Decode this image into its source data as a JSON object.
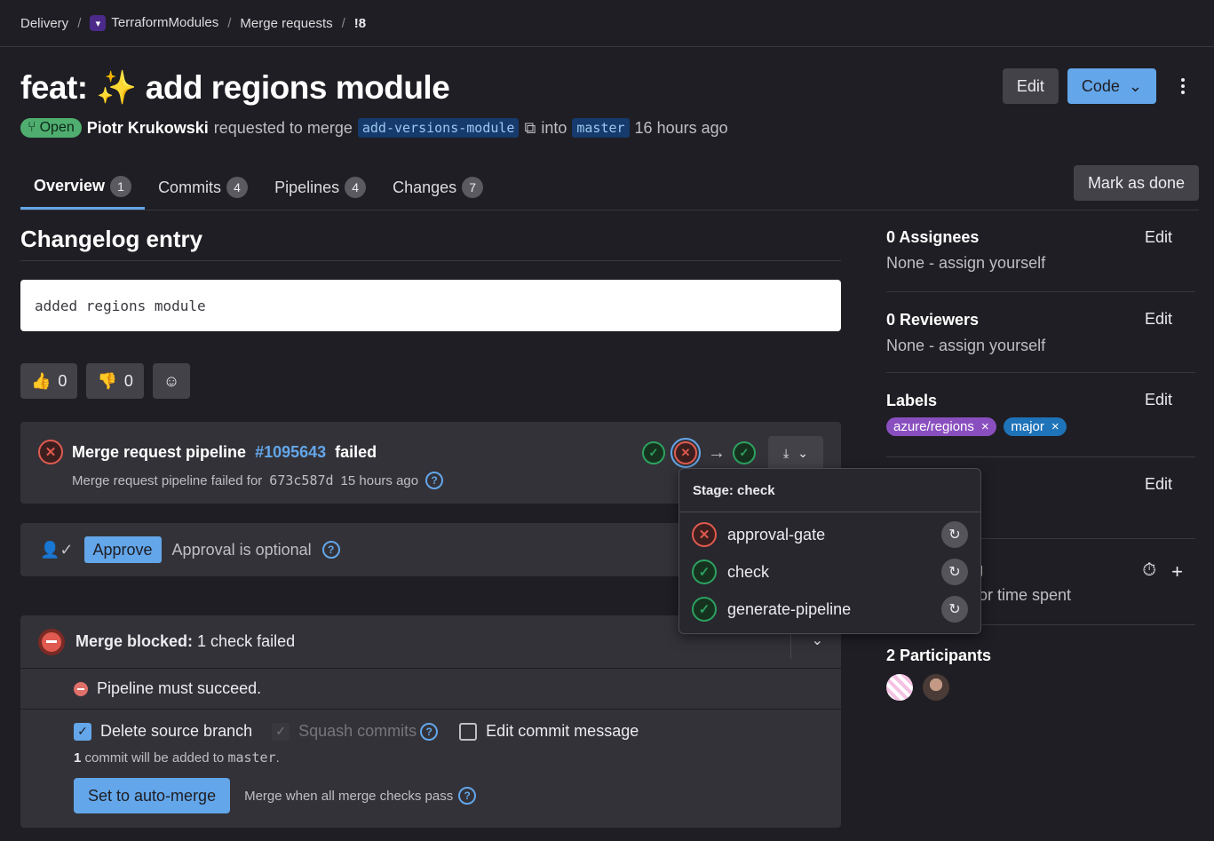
{
  "breadcrumb": [
    "Delivery",
    "TerraformModules",
    "Merge requests",
    "!8"
  ],
  "title": "feat: ✨ add regions module",
  "header": {
    "edit": "Edit",
    "code": "Code"
  },
  "meta": {
    "status": "Open",
    "author": "Piotr Krukowski",
    "action": "requested to merge",
    "source_branch": "add-versions-module",
    "into": "into",
    "target_branch": "master",
    "time": "16 hours ago"
  },
  "tabs": [
    {
      "label": "Overview",
      "count": "1"
    },
    {
      "label": "Commits",
      "count": "4"
    },
    {
      "label": "Pipelines",
      "count": "4"
    },
    {
      "label": "Changes",
      "count": "7"
    }
  ],
  "mark_done": "Mark as done",
  "changelog": {
    "title": "Changelog entry",
    "text": "added regions module"
  },
  "reactions": {
    "up": "0",
    "down": "0"
  },
  "pipeline": {
    "title_prefix": "Merge request pipeline",
    "id": "#1095643",
    "status": "failed",
    "sub_prefix": "Merge request pipeline failed for",
    "sha": "673c587d",
    "time": "15 hours ago"
  },
  "approval": {
    "button": "Approve",
    "text": "Approval is optional"
  },
  "merge": {
    "blocked_label": "Merge blocked:",
    "blocked_text": "1 check failed",
    "check": "Pipeline must succeed.",
    "opt_delete": "Delete source branch",
    "opt_squash": "Squash commits",
    "opt_edit": "Edit commit message",
    "commit_count": "1",
    "commit_note": "commit will be added to",
    "commit_target": "master",
    "auto_merge": "Set to auto-merge",
    "auto_note": "Merge when all merge checks pass"
  },
  "sidebar": {
    "assignees": {
      "title": "0 Assignees",
      "value": "None - assign yourself",
      "edit": "Edit"
    },
    "reviewers": {
      "title": "0 Reviewers",
      "value": "None - assign yourself",
      "edit": "Edit"
    },
    "labels": {
      "title": "Labels",
      "edit": "Edit",
      "items": [
        "azure/regions",
        "major"
      ]
    },
    "hidden_edit": "Edit",
    "time": {
      "title_frag": "g",
      "value_frag": "or time spent"
    },
    "participants": {
      "title": "2 Participants"
    }
  },
  "popover": {
    "title": "Stage: check",
    "jobs": [
      {
        "name": "approval-gate",
        "status": "failed"
      },
      {
        "name": "check",
        "status": "success"
      },
      {
        "name": "generate-pipeline",
        "status": "success"
      }
    ]
  },
  "colors": {
    "accent": "#63a6e9",
    "success": "#2da160",
    "danger": "#e05a4f"
  }
}
